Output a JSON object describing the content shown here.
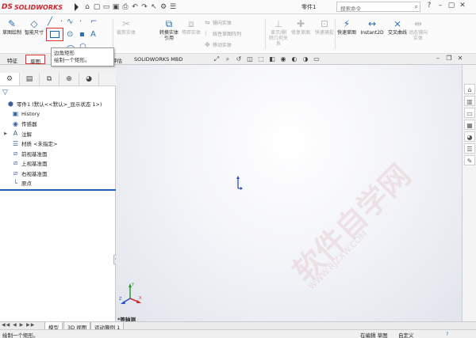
{
  "app": {
    "brand": "SOLIDWORKS",
    "brand_prefix": "DS",
    "doc_title": "零件1",
    "search_placeholder": "搜索命令"
  },
  "quick_access": [
    "home-icon",
    "new-icon",
    "open-icon",
    "save-icon",
    "print-icon",
    "undo-icon",
    "select-icon",
    "options-icon"
  ],
  "ribbon": {
    "sketch_draw": "草图绘制",
    "smart_dim": "智能尺寸",
    "convert": "转换实体引用",
    "equidistant": "等距实体",
    "mirror": "镜向实体",
    "linear_array": "线性草图阵列",
    "move": "移动实体",
    "show_relations": "显示/删除几何关系",
    "repair": "修复草图",
    "quick_snap": "快速捕捉",
    "quick_sketch": "快速草图",
    "instant2d": "Instant2D",
    "shaded_sketch": "交叉曲线",
    "dynamic_mirror": "动态镜向实体"
  },
  "tooltip": {
    "title": "边角矩形",
    "desc": "绘制一个矩形。"
  },
  "tabs": {
    "features": "特征",
    "sketch": "草图",
    "evaluate": "评估",
    "mbd": "SOLIDWORKS MBD"
  },
  "tree": {
    "root": "零件1 (默认<<默认>_显示状态 1>)",
    "items": [
      {
        "label": "History",
        "icon": "history-icon"
      },
      {
        "label": "传感器",
        "icon": "sensor-icon"
      },
      {
        "label": "注解",
        "icon": "annotation-icon"
      },
      {
        "label": "材质 <未指定>",
        "icon": "material-icon"
      },
      {
        "label": "前视基准面",
        "icon": "plane-icon"
      },
      {
        "label": "上视基准面",
        "icon": "plane-icon"
      },
      {
        "label": "右视基准面",
        "icon": "plane-icon"
      },
      {
        "label": "原点",
        "icon": "origin-icon"
      }
    ]
  },
  "viewport": {
    "view_label": "*等轴测",
    "watermark": "软件自学网",
    "watermark_url": "WWW.RJZXW.COM"
  },
  "bottom_tabs": [
    "模型",
    "3D 视图",
    "运动算例 1"
  ],
  "status": {
    "left": "绘制一个矩形。",
    "mode": "在编辑 草图",
    "custom": "自定义",
    "help": "?"
  }
}
